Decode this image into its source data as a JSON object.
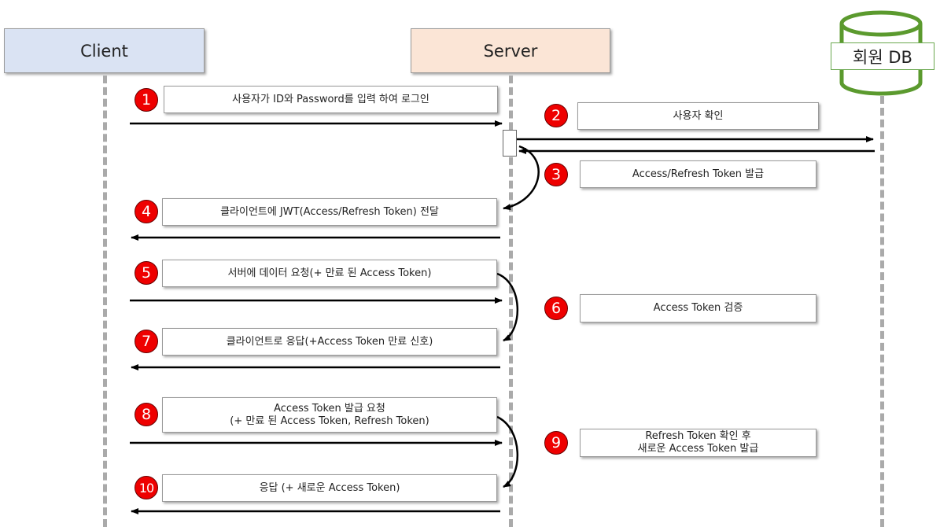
{
  "actors": {
    "client": {
      "label": "Client",
      "fill": "#dae3f3"
    },
    "server": {
      "label": "Server",
      "fill": "#fbe5d6"
    },
    "db": {
      "label": "회원 DB",
      "stroke": "#5b9a2e"
    }
  },
  "steps": [
    {
      "num": "1",
      "text": "사용자가 ID와 Password를 입력 하여 로그인"
    },
    {
      "num": "2",
      "text": "사용자 확인"
    },
    {
      "num": "3",
      "text": "Access/Refresh Token 발급"
    },
    {
      "num": "4",
      "text": "클라이언트에 JWT(Access/Refresh Token) 전달"
    },
    {
      "num": "5",
      "text": "서버에 데이터 요청(+ 만료 된 Access Token)"
    },
    {
      "num": "6",
      "text": "Access Token 검증"
    },
    {
      "num": "7",
      "text": "클라이언트로 응답(+Access Token 만료 신호)"
    },
    {
      "num": "8",
      "text": "Access Token 발급 요청\n(+ 만료 된 Access Token, Refresh Token)"
    },
    {
      "num": "9",
      "text": "Refresh Token 확인 후\n새로운 Access Token 발급"
    },
    {
      "num": "10",
      "text": "응답 (+ 새로운 Access Token)"
    }
  ],
  "colors": {
    "badge": "#ee0000",
    "arrow": "#000000",
    "lifeline": "#aaaaaa"
  }
}
